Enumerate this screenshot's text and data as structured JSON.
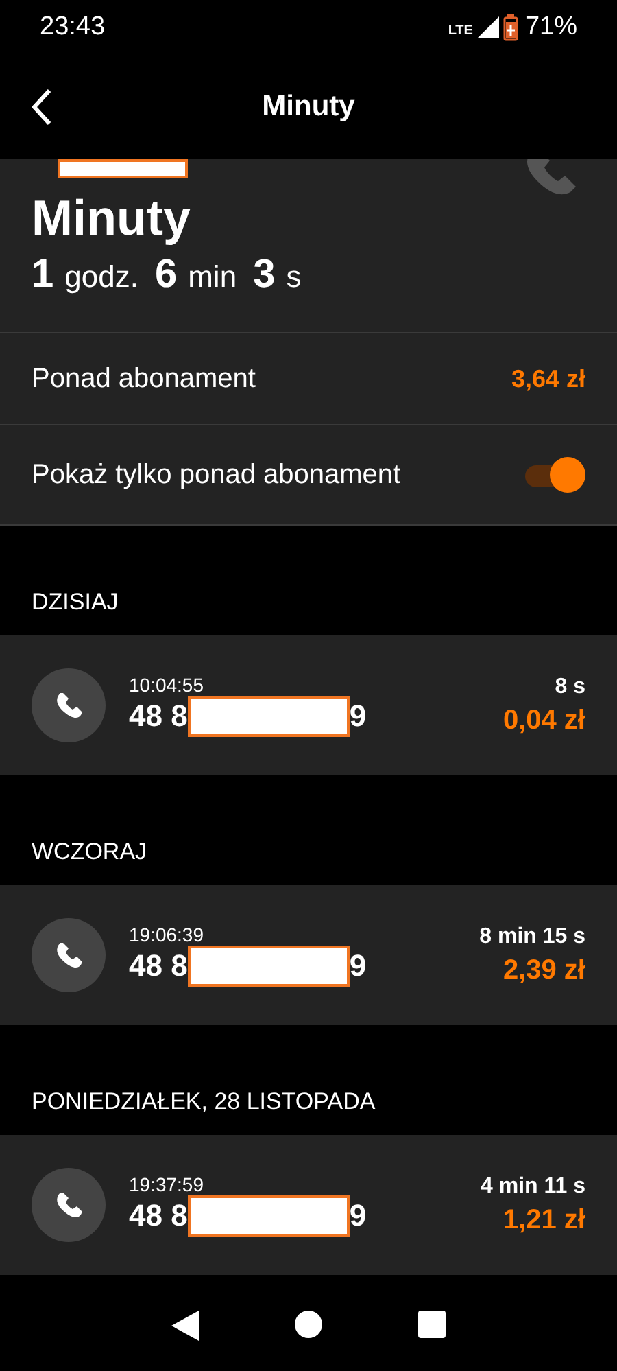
{
  "status_bar": {
    "time": "23:43",
    "network": "LTE",
    "battery": "71%"
  },
  "header": {
    "title": "Minuty"
  },
  "summary": {
    "title": "Minuty",
    "duration": [
      {
        "value": "1",
        "unit": "godz."
      },
      {
        "value": "6",
        "unit": "min"
      },
      {
        "value": "3",
        "unit": "s"
      }
    ]
  },
  "extra": {
    "label": "Ponad abonament",
    "amount": "3,64 zł"
  },
  "filter": {
    "label": "Pokaż tylko ponad abonament",
    "on": true
  },
  "days": [
    {
      "label": "DZISIAJ",
      "calls": [
        {
          "time": "10:04:55",
          "number_start": "48 8",
          "number_end": "9",
          "duration": "8 s",
          "cost": "0,04 zł"
        }
      ]
    },
    {
      "label": "WCZORAJ",
      "calls": [
        {
          "time": "19:06:39",
          "number_start": "48 8",
          "number_end": "9",
          "duration": "8 min 15 s",
          "cost": "2,39 zł"
        }
      ]
    },
    {
      "label": "PONIEDZIAŁEK, 28 LISTOPADA",
      "calls": [
        {
          "time": "19:37:59",
          "number_start": "48 8",
          "number_end": "9",
          "duration": "4 min 11 s",
          "cost": "1,21 zł"
        }
      ]
    }
  ]
}
